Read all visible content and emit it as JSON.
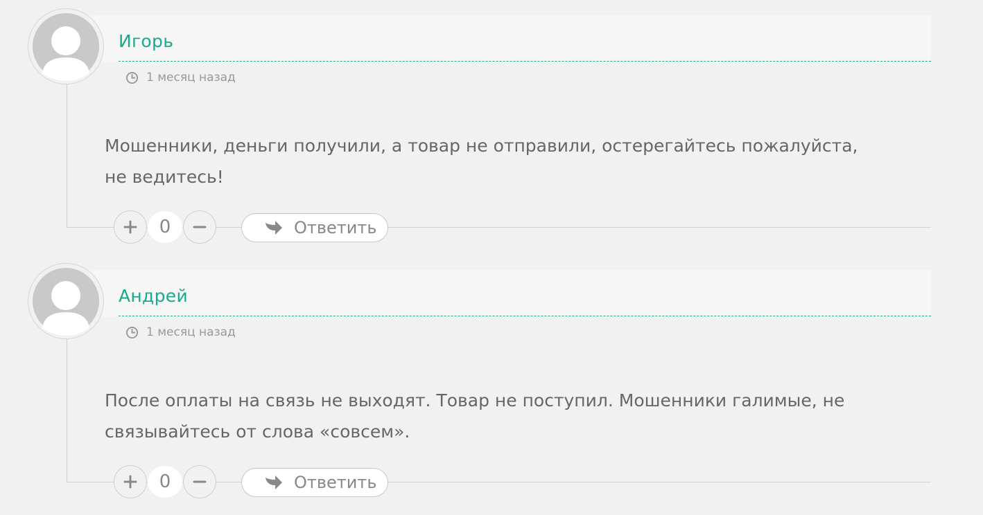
{
  "comments": [
    {
      "author": "Игорь",
      "time": "1 месяц назад",
      "text": "Мошенники, деньги получили, а товар не отправили, остерегайтесь пожалуйста, не ведитесь!",
      "votes": "0",
      "reply_label": "Ответить"
    },
    {
      "author": "Андрей",
      "time": "1 месяц назад",
      "text": "После оплаты на связь не выходят. Товар не поступил. Мошенники галимые, не связывайтесь от слова «совсем».",
      "votes": "0",
      "reply_label": "Ответить"
    }
  ],
  "colors": {
    "accent": "#1aa98a",
    "background": "#f1f1f1",
    "text": "#666666",
    "muted": "#999999"
  },
  "icons": {
    "avatar": "default-user-avatar",
    "time": "clock-icon",
    "vote_up": "plus-icon",
    "vote_down": "minus-icon",
    "reply": "reply-arrow-icon"
  }
}
